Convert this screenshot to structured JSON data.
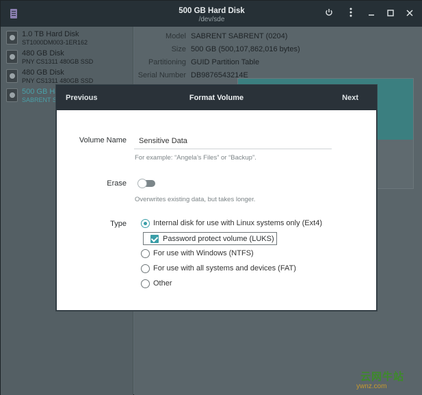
{
  "window": {
    "title": "500 GB Hard Disk",
    "subtitle": "/dev/sde"
  },
  "titlebar_icons": [
    "power-icon",
    "menu-kebab-icon",
    "minimize-icon",
    "maximize-icon",
    "close-icon"
  ],
  "sidebar": {
    "items": [
      {
        "name": "1.0 TB Hard Disk",
        "model": "ST1000DM003-1ER162"
      },
      {
        "name": "480 GB Disk",
        "model": "PNY CS1311 480GB SSD"
      },
      {
        "name": "480 GB Disk",
        "model": "PNY CS1311 480GB SSD"
      },
      {
        "name": "500 GB Ha",
        "model": "SABRENT SA"
      }
    ],
    "selected_index": 3
  },
  "details": [
    {
      "key": "Model",
      "value": "SABRENT SABRENT (0204)"
    },
    {
      "key": "Size",
      "value": "500 GB (500,107,862,016 bytes)"
    },
    {
      "key": "Partitioning",
      "value": "GUID Partition Table"
    },
    {
      "key": "Serial Number",
      "value": "DB9876543214E"
    }
  ],
  "dialog": {
    "prev_label": "Previous",
    "title": "Format Volume",
    "next_label": "Next",
    "volume_name_label": "Volume Name",
    "volume_name_value": "Sensitive Data",
    "volume_name_hint": "For example: “Angela’s Files” or “Backup”.",
    "erase_label": "Erase",
    "erase_on": false,
    "erase_hint": "Overwrites existing data, but takes longer.",
    "type_label": "Type",
    "types": [
      {
        "label": "Internal disk for use with Linux systems only (Ext4)",
        "checked": true
      },
      {
        "label": "For use with Windows (NTFS)",
        "checked": false
      },
      {
        "label": "For use with all systems and devices (FAT)",
        "checked": false
      },
      {
        "label": "Other",
        "checked": false
      }
    ],
    "luks_label": "Password protect volume (LUKS)",
    "luks_checked": true
  },
  "colors": {
    "accent": "#3a9ea8",
    "titlebar": "#263036",
    "partition_fill": "#3b7f80"
  },
  "watermark": {
    "line1": "云网牛站",
    "line2": "ywnz.com"
  }
}
